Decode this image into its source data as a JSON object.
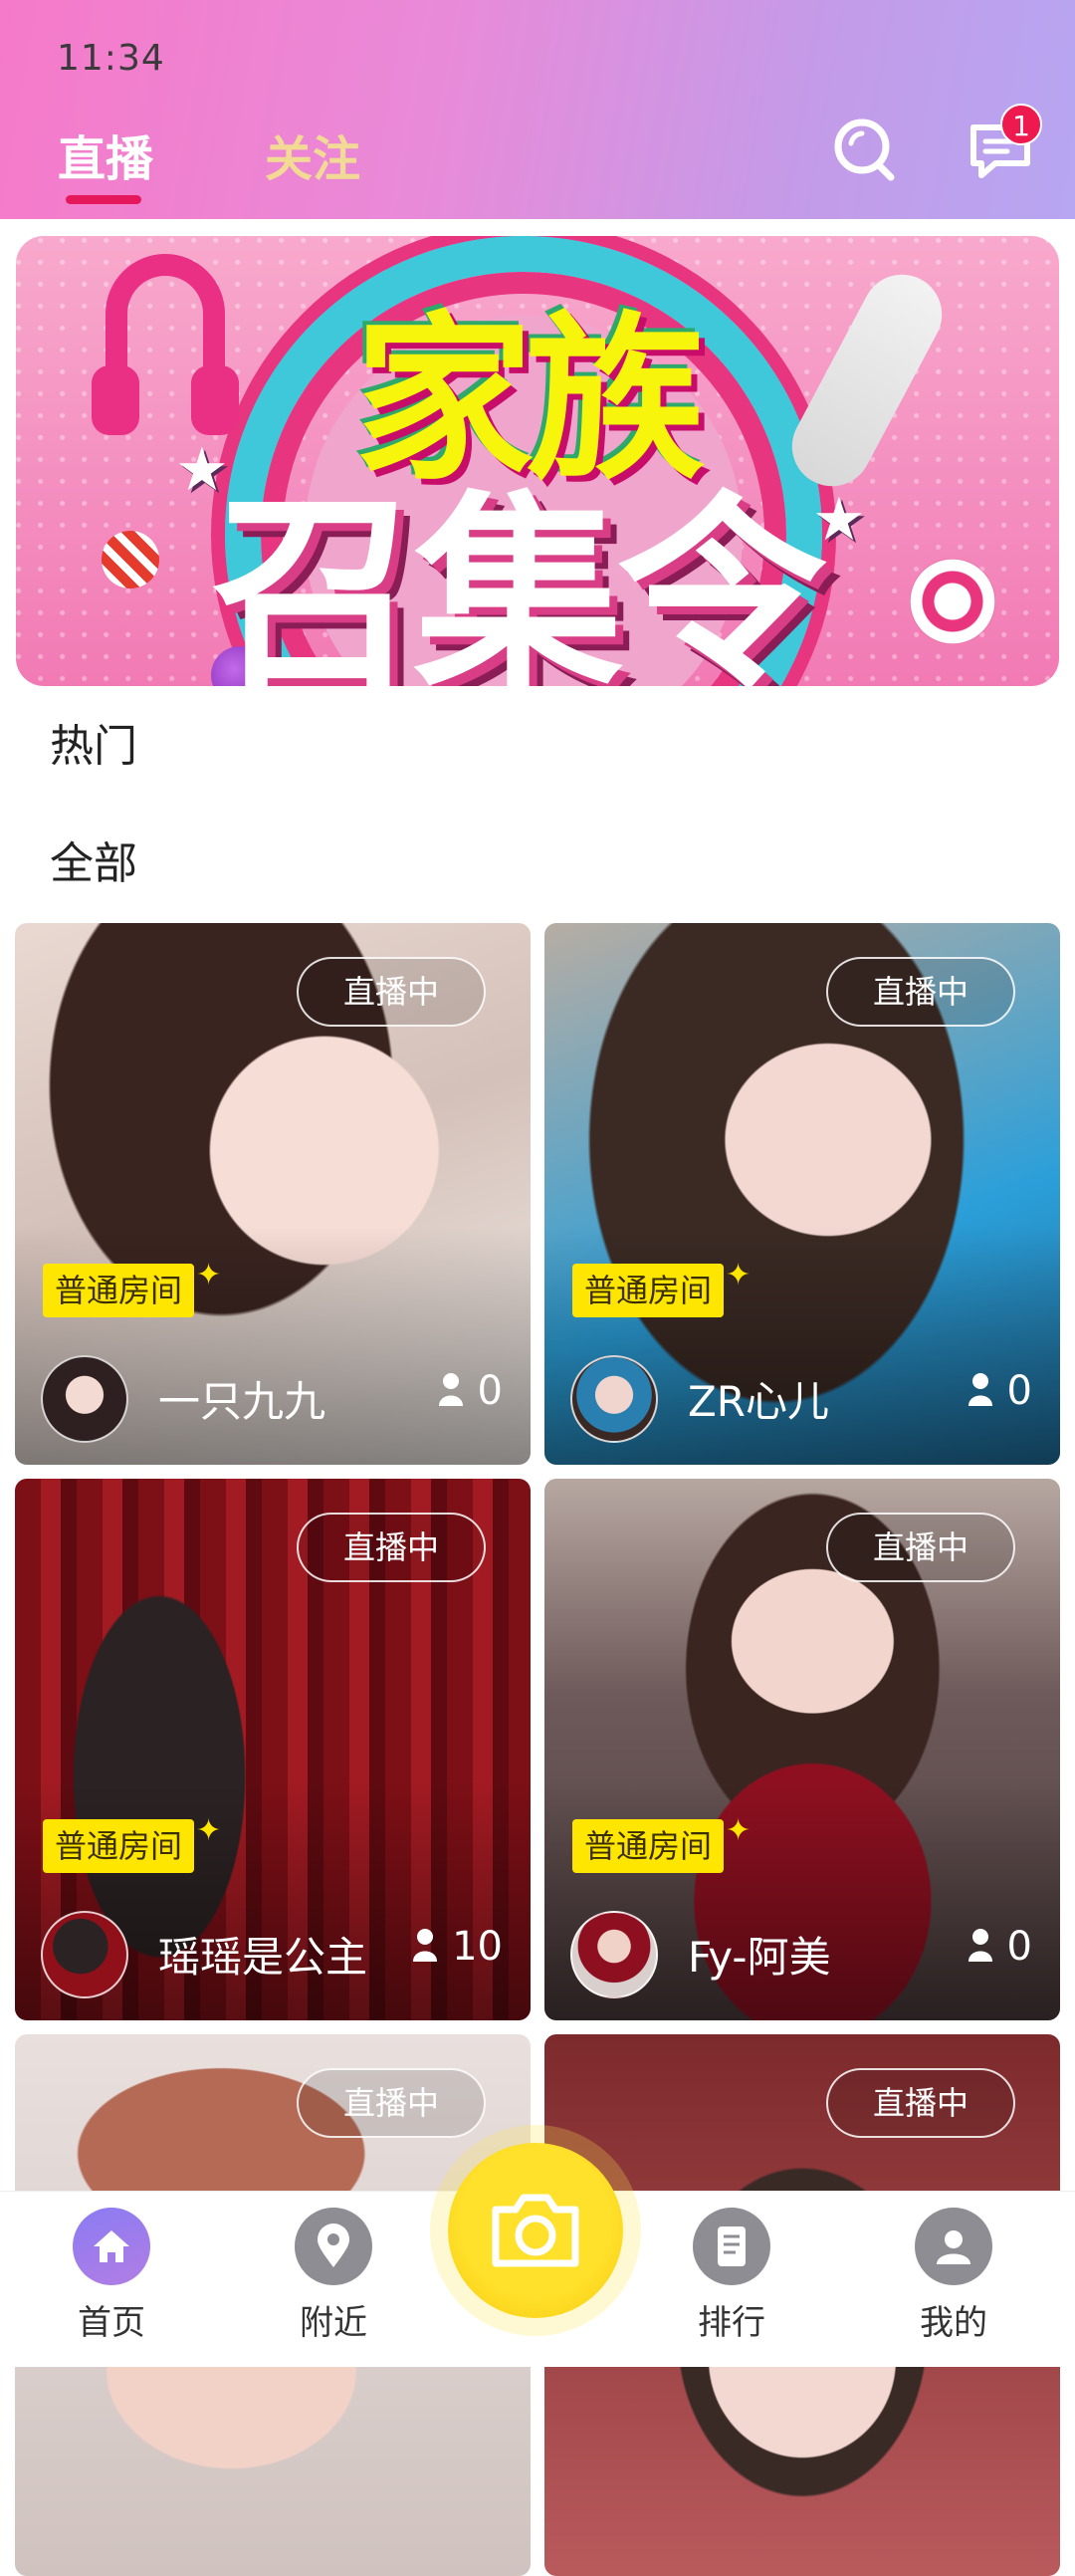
{
  "status_bar": {
    "time": "11:34"
  },
  "header": {
    "tabs": [
      {
        "label": "直播",
        "active": true
      },
      {
        "label": "关注",
        "active": false
      }
    ],
    "message_badge": "1",
    "icons": {
      "search": "search-icon",
      "messages": "message-icon"
    }
  },
  "banner": {
    "title_line1": "家族",
    "title_line2": "召集令"
  },
  "sections": {
    "hot": "热门",
    "all": "全部"
  },
  "cards": [
    {
      "status": "直播中",
      "room_tag": "普通房间",
      "host": "一只九九",
      "viewers": "0"
    },
    {
      "status": "直播中",
      "room_tag": "普通房间",
      "host": "ZR心儿",
      "viewers": "0"
    },
    {
      "status": "直播中",
      "room_tag": "普通房间",
      "host": "瑶瑶是公主",
      "viewers": "10"
    },
    {
      "status": "直播中",
      "room_tag": "普通房间",
      "host": "Fy-阿美",
      "viewers": "0"
    },
    {
      "status": "直播中"
    },
    {
      "status": "直播中"
    }
  ],
  "bottom_nav": [
    {
      "label": "首页",
      "icon": "home-icon",
      "active": true
    },
    {
      "label": "附近",
      "icon": "location-icon"
    },
    {
      "label": "排行",
      "icon": "ranking-icon"
    },
    {
      "label": "我的",
      "icon": "profile-icon"
    }
  ],
  "center_action": {
    "icon": "camera-icon"
  },
  "colors": {
    "header_gradient_start": "#f57ac9",
    "header_gradient_end": "#b7a6f2",
    "tab_indicator": "#e5185c",
    "room_tag": "#ffe600",
    "camera_button": "#ffe02a",
    "nav_active": "#8a7cf3"
  }
}
